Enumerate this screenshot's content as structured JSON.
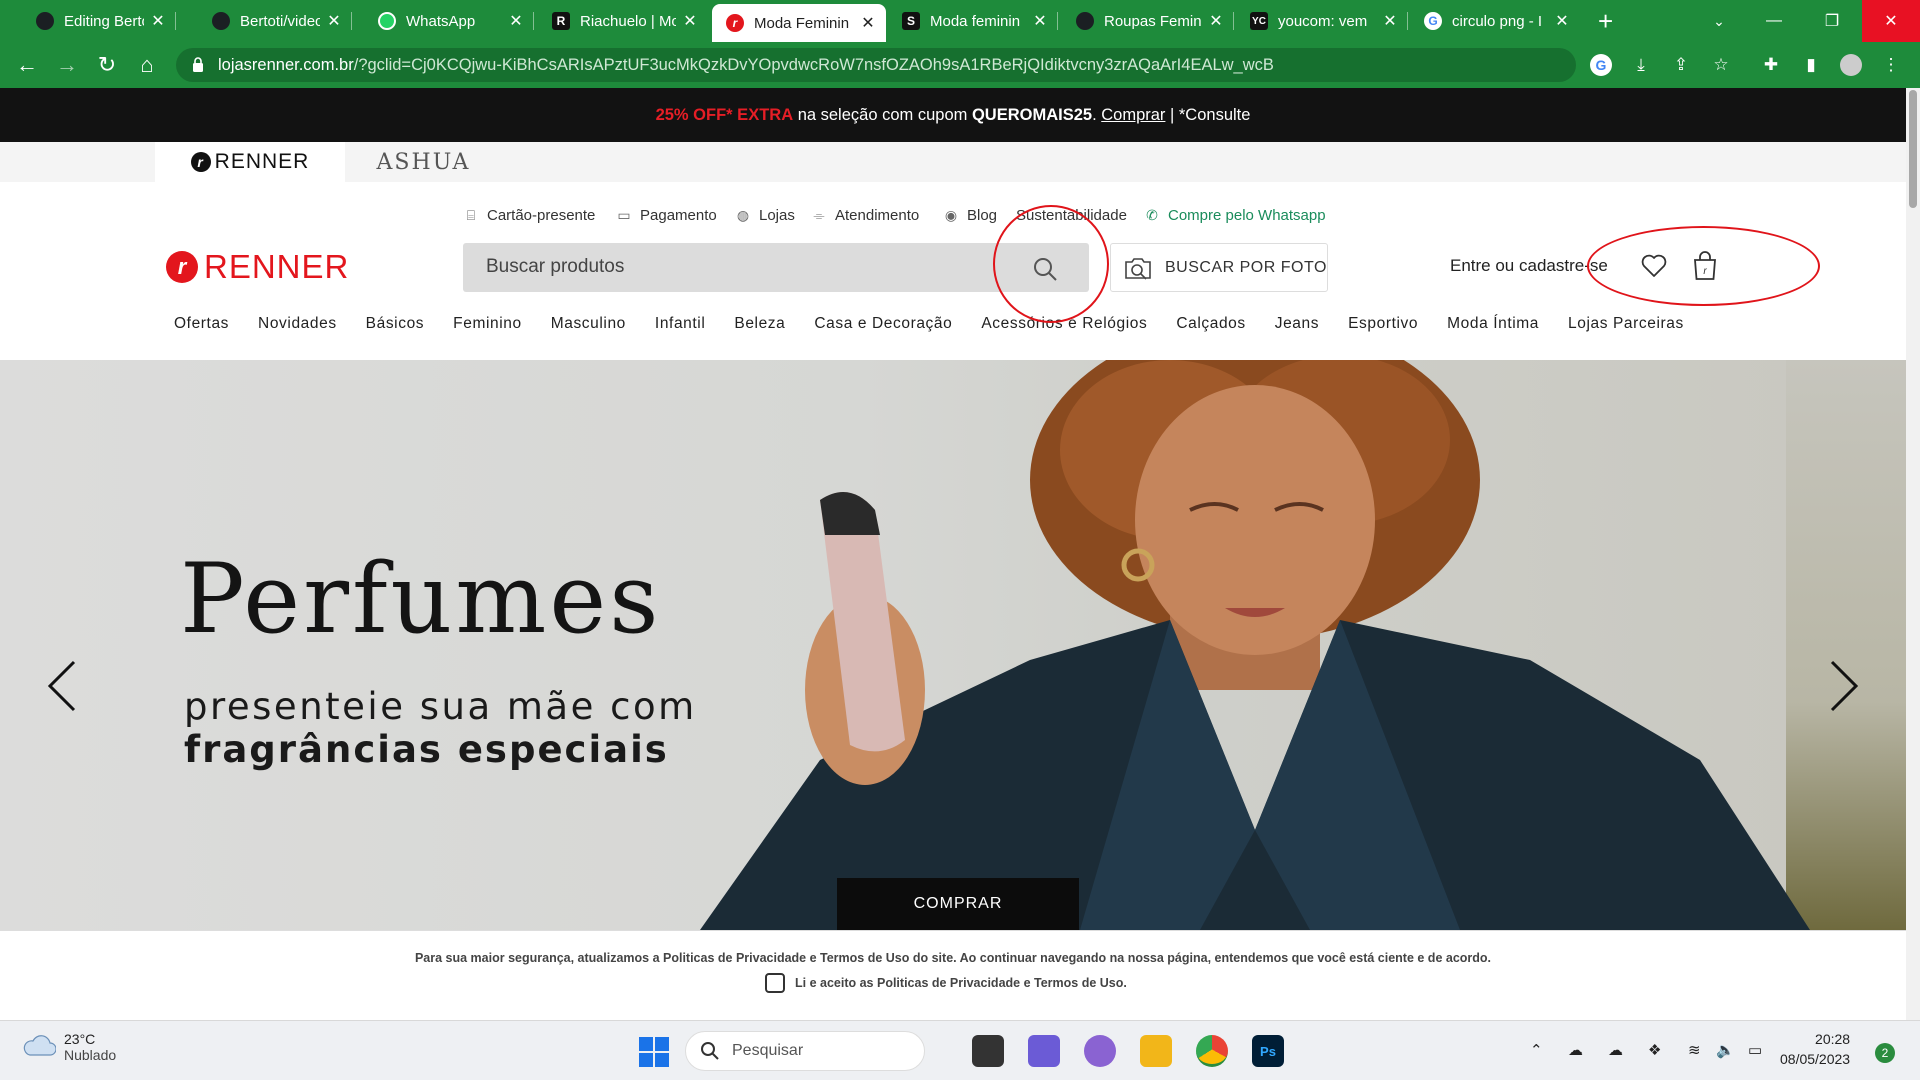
{
  "browser": {
    "tabs": [
      {
        "title": "Editing Bertoti",
        "favicon": "github-icon",
        "color": "#1b1f23"
      },
      {
        "title": "Bertoti/video-",
        "favicon": "github-icon",
        "color": "#1b1f23"
      },
      {
        "title": "WhatsApp",
        "favicon": "whatsapp-icon",
        "color": "#25d366"
      },
      {
        "title": "Riachuelo | Mo",
        "favicon": "riachuelo-icon",
        "letter": "R",
        "color": "#111111"
      },
      {
        "title": "Moda Feminin",
        "favicon": "renner-icon",
        "color": "#e3161d",
        "active": true
      },
      {
        "title": "Moda feminin",
        "favicon": "shein-icon",
        "letter": "S",
        "color": "#111111"
      },
      {
        "title": "Roupas Femin",
        "favicon": "cea-icon",
        "color": "#1b1f23"
      },
      {
        "title": "youcom: vem",
        "favicon": "youcom-icon",
        "letter": "YC",
        "color": "#111111"
      },
      {
        "title": "circulo png - I",
        "favicon": "google-icon",
        "color": "#ffffff"
      }
    ],
    "url_host": "lojasrenner.com.br",
    "url_path": "/?gclid=Cj0KCQjwu-KiBhCsARIsAPztUF3ucMkQzkDvYOpvdwcRoW7nsfOZAOh9sA1RBeRjQIdiktvcny3zrAQaArI4EALw_wcB",
    "theme_color": "#1e8b3b"
  },
  "promo": {
    "offer": "25% OFF* EXTRA",
    "text_mid": " na seleção com cupom ",
    "coupon": "QUEROMAIS25",
    "dot": ". ",
    "link": "Comprar",
    "suffix": " | *Consulte"
  },
  "brands": {
    "renner": "RENNER",
    "ashua": "ASHUA"
  },
  "utility_links": [
    {
      "label": "Cartão-presente",
      "icon": "gift-icon"
    },
    {
      "label": "Pagamento",
      "icon": "card-icon"
    },
    {
      "label": "Lojas",
      "icon": "store-icon"
    },
    {
      "label": "Atendimento",
      "icon": "chat-icon"
    },
    {
      "label": "Blog",
      "icon": "blog-icon"
    },
    {
      "label": "Sustentabilidade",
      "icon": null
    },
    {
      "label": "Compre pelo Whatsapp",
      "icon": "whatsapp-icon"
    }
  ],
  "header": {
    "logo": "RENNER",
    "search_placeholder": "Buscar produtos",
    "photo_search": "BUSCAR POR FOTO",
    "account": "Entre ou cadastre-se"
  },
  "categories": [
    "Ofertas",
    "Novidades",
    "Básicos",
    "Feminino",
    "Masculino",
    "Infantil",
    "Beleza",
    "Casa e Decoração",
    "Acessórios e Relógios",
    "Calçados",
    "Jeans",
    "Esportivo",
    "Moda Íntima",
    "Lojas Parceiras"
  ],
  "hero": {
    "title": "Perfumes",
    "line1": "presenteie sua mãe com",
    "line2": "fragrâncias especiais",
    "cta": "COMPRAR"
  },
  "cookie": {
    "message": "Para sua maior segurança, atualizamos a Politicas de Privacidade e Termos de Uso do site. Ao continuar navegando na nossa página, entendemos que você está ciente e de acordo.",
    "checkbox": "Li e aceito as Politicas de Privacidade e Termos de Uso."
  },
  "taskbar": {
    "temp": "23°C",
    "weather": "Nublado",
    "search": "Pesquisar",
    "time": "20:28",
    "date": "08/05/2023",
    "notifications": "2"
  }
}
